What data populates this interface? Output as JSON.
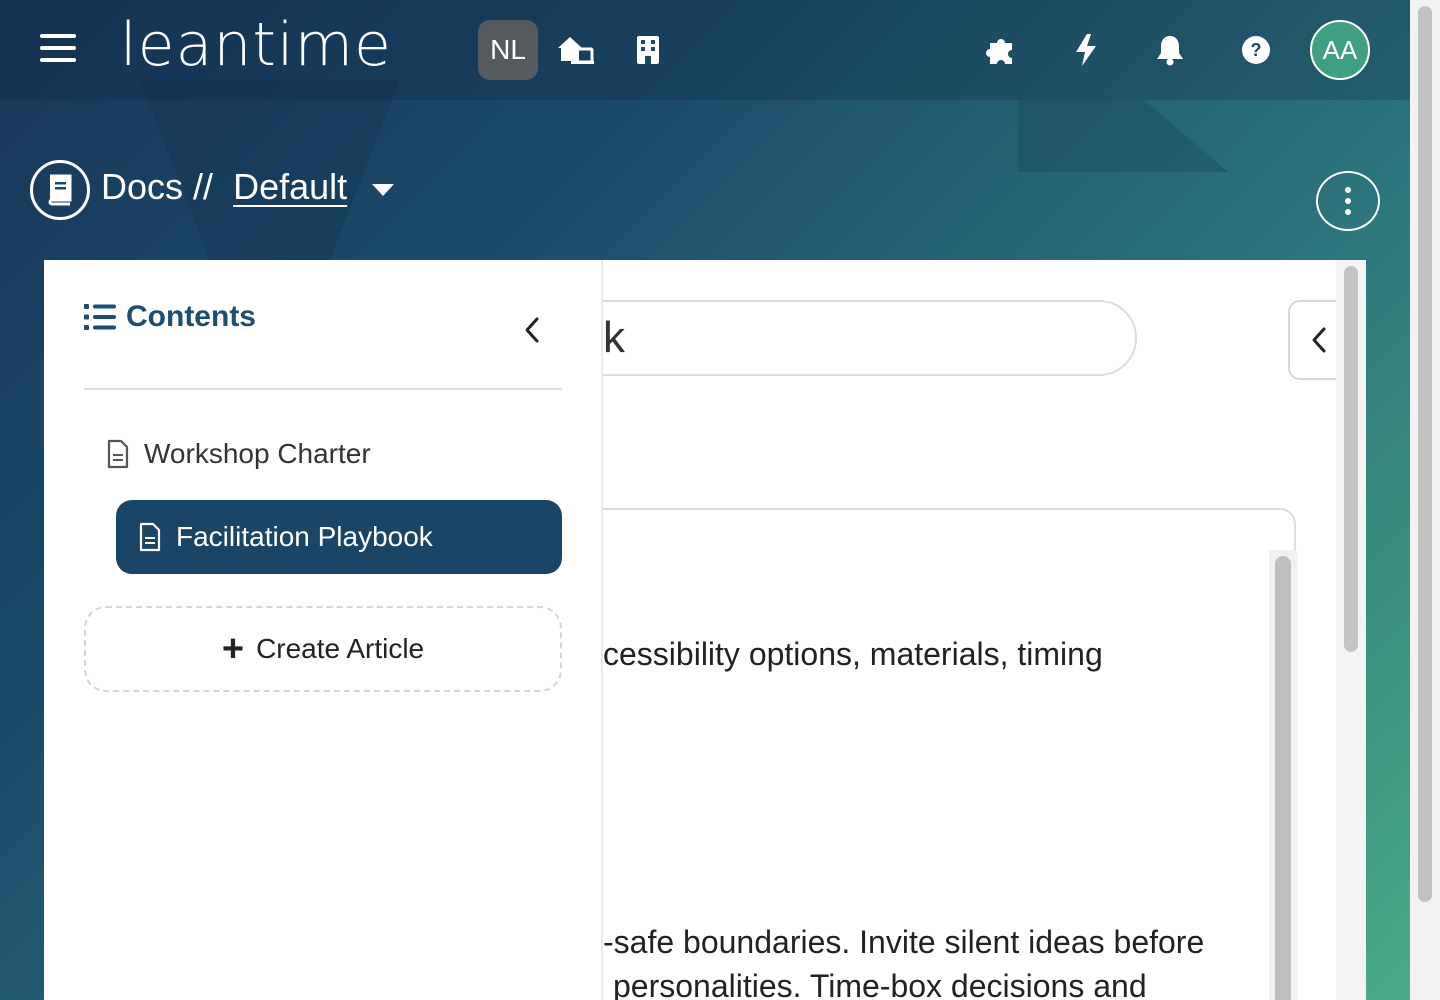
{
  "header": {
    "logo": "leantime",
    "project_badge": "NL",
    "avatar_initials": "AA",
    "icons": [
      "menu-icon",
      "home-office-icon",
      "building-icon",
      "puzzle-icon",
      "lightning-icon",
      "bell-icon",
      "help-icon"
    ]
  },
  "page_header": {
    "section": "Docs",
    "separator": "//",
    "board": "Default",
    "icon": "book-icon"
  },
  "sidebar": {
    "heading": "Contents",
    "articles": [
      {
        "label": "Workshop Charter",
        "active": false
      },
      {
        "label": "Facilitation Playbook",
        "active": true
      }
    ],
    "create_label": "Create Article"
  },
  "editor": {
    "title_fragment": "k",
    "line1": "cessibility options, materials, timing",
    "line2": "-safe boundaries. Invite silent ideas before",
    "line3": "personalities. Time-box decisions and"
  },
  "colors": {
    "accent": "#1a4567",
    "heading": "#1d4d72",
    "avatar_bg": "#3f9f82"
  }
}
